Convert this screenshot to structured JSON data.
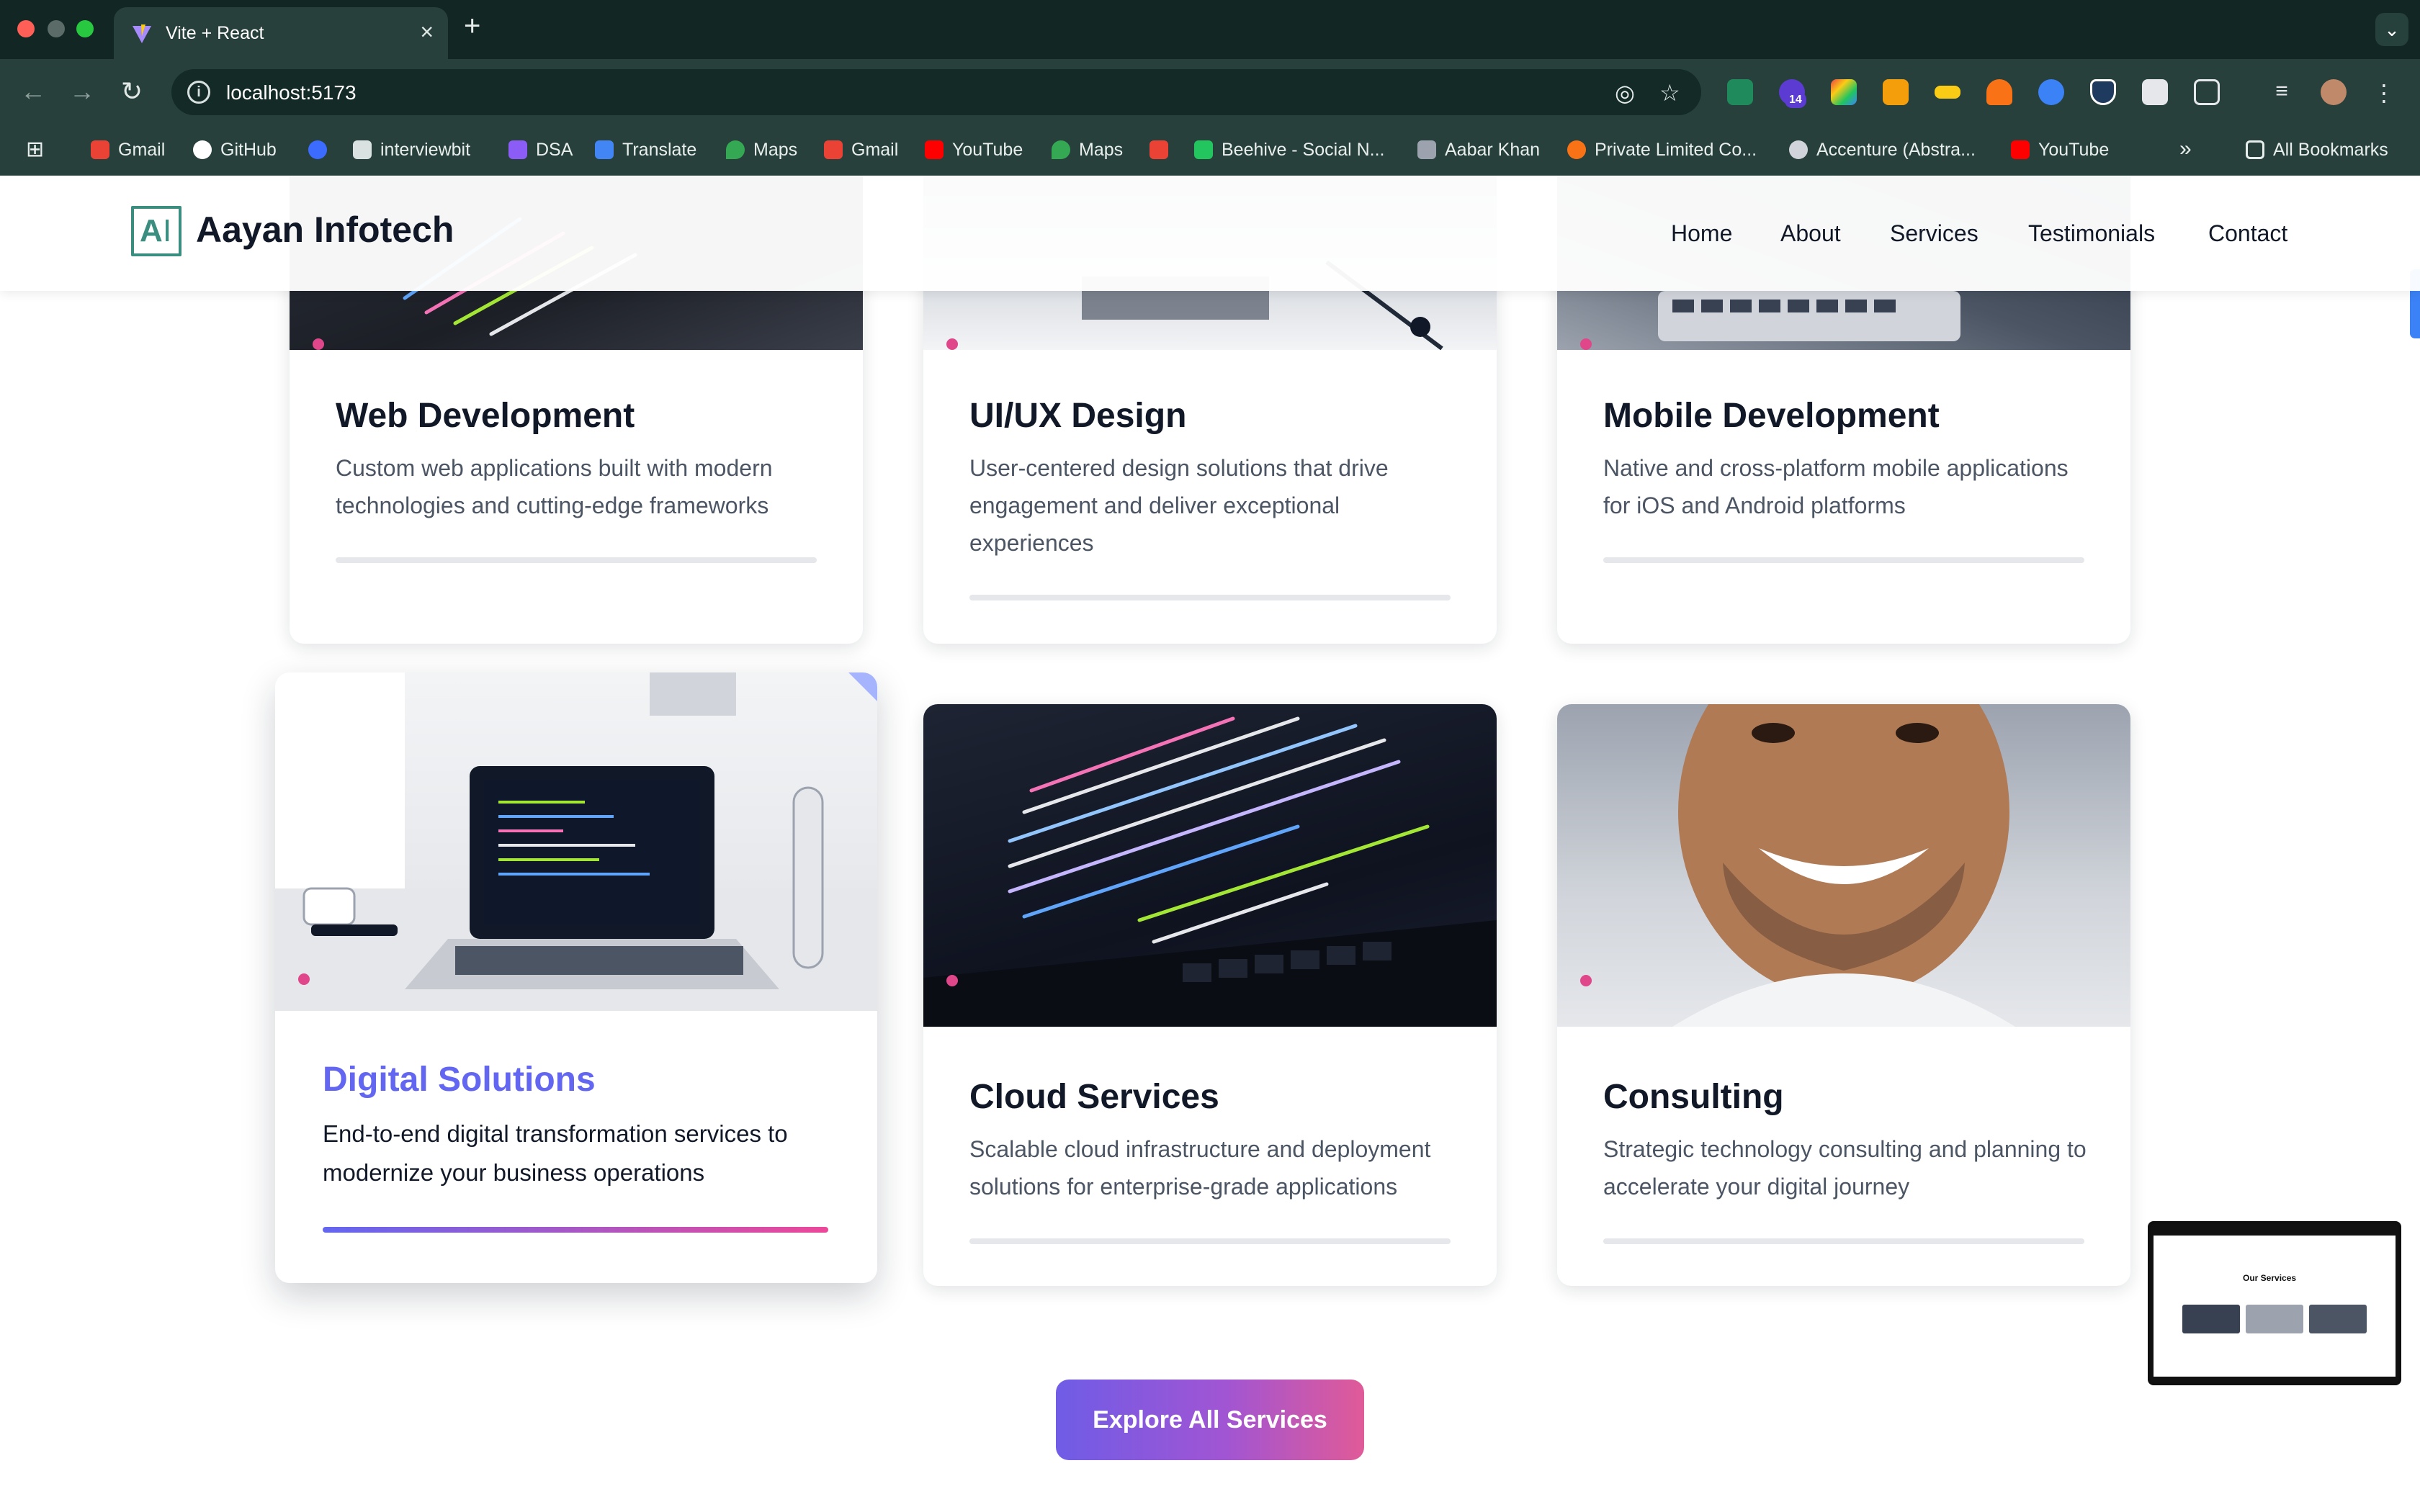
{
  "browser": {
    "tab_title": "Vite + React",
    "url": "localhost:5173",
    "extension_badge": "14",
    "bookmarks": [
      {
        "label": "Gmail",
        "color": "#ea4335"
      },
      {
        "label": "GitHub",
        "color": "#ffffff"
      },
      {
        "label": "",
        "color": "#3b6cff"
      },
      {
        "label": "interviewbit",
        "color": "#d9e2e0"
      },
      {
        "label": "DSA",
        "color": "#8b5cf6"
      },
      {
        "label": "Translate",
        "color": "#4285f4"
      },
      {
        "label": "Maps",
        "color": "#34a853"
      },
      {
        "label": "Gmail",
        "color": "#ea4335"
      },
      {
        "label": "YouTube",
        "color": "#ff0000"
      },
      {
        "label": "Maps",
        "color": "#34a853"
      },
      {
        "label": "",
        "color": "#ea4335"
      },
      {
        "label": "Beehive - Social N...",
        "color": "#22c55e"
      },
      {
        "label": "Aabar Khan",
        "color": "#9ca3af"
      },
      {
        "label": "Private Limited Co...",
        "color": "#f97316"
      },
      {
        "label": "Accenture (Abstra...",
        "color": "#d1d5db"
      },
      {
        "label": "YouTube",
        "color": "#ff0000"
      }
    ],
    "bookmarks_overflow": "»",
    "all_bookmarks": "All Bookmarks"
  },
  "site": {
    "logo_letters": {
      "a": "A",
      "i": "I"
    },
    "brand": "Aayan Infotech",
    "nav": [
      "Home",
      "About",
      "Services",
      "Testimonials",
      "Contact"
    ]
  },
  "services": [
    {
      "title": "Web Development",
      "description": "Custom web applications built with modern technologies and cutting-edge frameworks",
      "image": "code-screen"
    },
    {
      "title": "UI/UX Design",
      "description": "User-centered design solutions that drive engagement and deliver exceptional experiences",
      "image": "electronics"
    },
    {
      "title": "Mobile Development",
      "description": "Native and cross-platform mobile applications for iOS and Android platforms",
      "image": "laptop-keyboard"
    },
    {
      "title": "Digital Solutions",
      "description": "End-to-end digital transformation services to modernize your business operations",
      "image": "laptop-desk",
      "active": true
    },
    {
      "title": "Cloud Services",
      "description": "Scalable cloud infrastructure and deployment solutions for enterprise-grade applications",
      "image": "code-closeup"
    },
    {
      "title": "Consulting",
      "description": "Strategic technology consulting and planning to accelerate your digital journey",
      "image": "portrait"
    }
  ],
  "cta": {
    "label": "Explore All Services"
  },
  "preview": {
    "title": "Our Services"
  },
  "colors": {
    "accent_purple": "#6b5ce7",
    "accent_pink": "#e0478b",
    "title_dark": "#111827",
    "logo_teal": "#3a8d7f"
  }
}
